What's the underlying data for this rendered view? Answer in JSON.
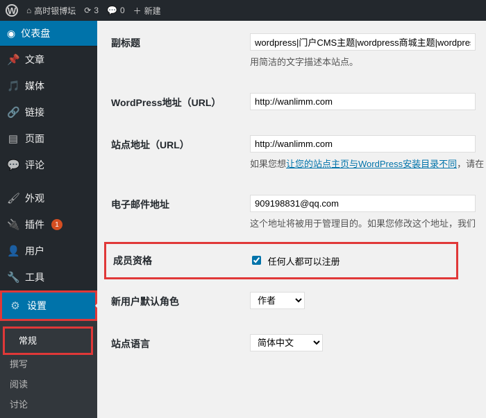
{
  "adminbar": {
    "site_name": "高时银博坛",
    "updates_count": "3",
    "comments_count": "0",
    "new_label": "新建"
  },
  "sidebar": {
    "dashboard": "仪表盘",
    "posts": "文章",
    "media": "媒体",
    "links": "链接",
    "pages": "页面",
    "comments": "评论",
    "appearance": "外观",
    "plugins": "插件",
    "plugins_badge": "1",
    "users": "用户",
    "tools": "工具",
    "settings": "设置",
    "sub_general": "常规",
    "sub_writing": "撰写",
    "sub_reading": "阅读",
    "sub_discussion": "讨论"
  },
  "form": {
    "tagline_label": "副标题",
    "tagline_value": "wordpress|门户CMS主题|wordpress商城主题|wordpress",
    "tagline_desc": "用简洁的文字描述本站点。",
    "wpurl_label": "WordPress地址（URL）",
    "wpurl_value": "http://wanlimm.com",
    "siteurl_label": "站点地址（URL）",
    "siteurl_value": "http://wanlimm.com",
    "siteurl_desc_pre": "如果您想",
    "siteurl_desc_link": "让您的站点主页与WordPress安装目录不同",
    "siteurl_desc_post": "，请在",
    "email_label": "电子邮件地址",
    "email_value": "909198831@qq.com",
    "email_desc": "这个地址将被用于管理目的。如果您修改这个地址，我们",
    "membership_label": "成员资格",
    "membership_check": "任何人都可以注册",
    "role_label": "新用户默认角色",
    "role_value": "作者",
    "lang_label": "站点语言",
    "lang_value": "简体中文"
  }
}
